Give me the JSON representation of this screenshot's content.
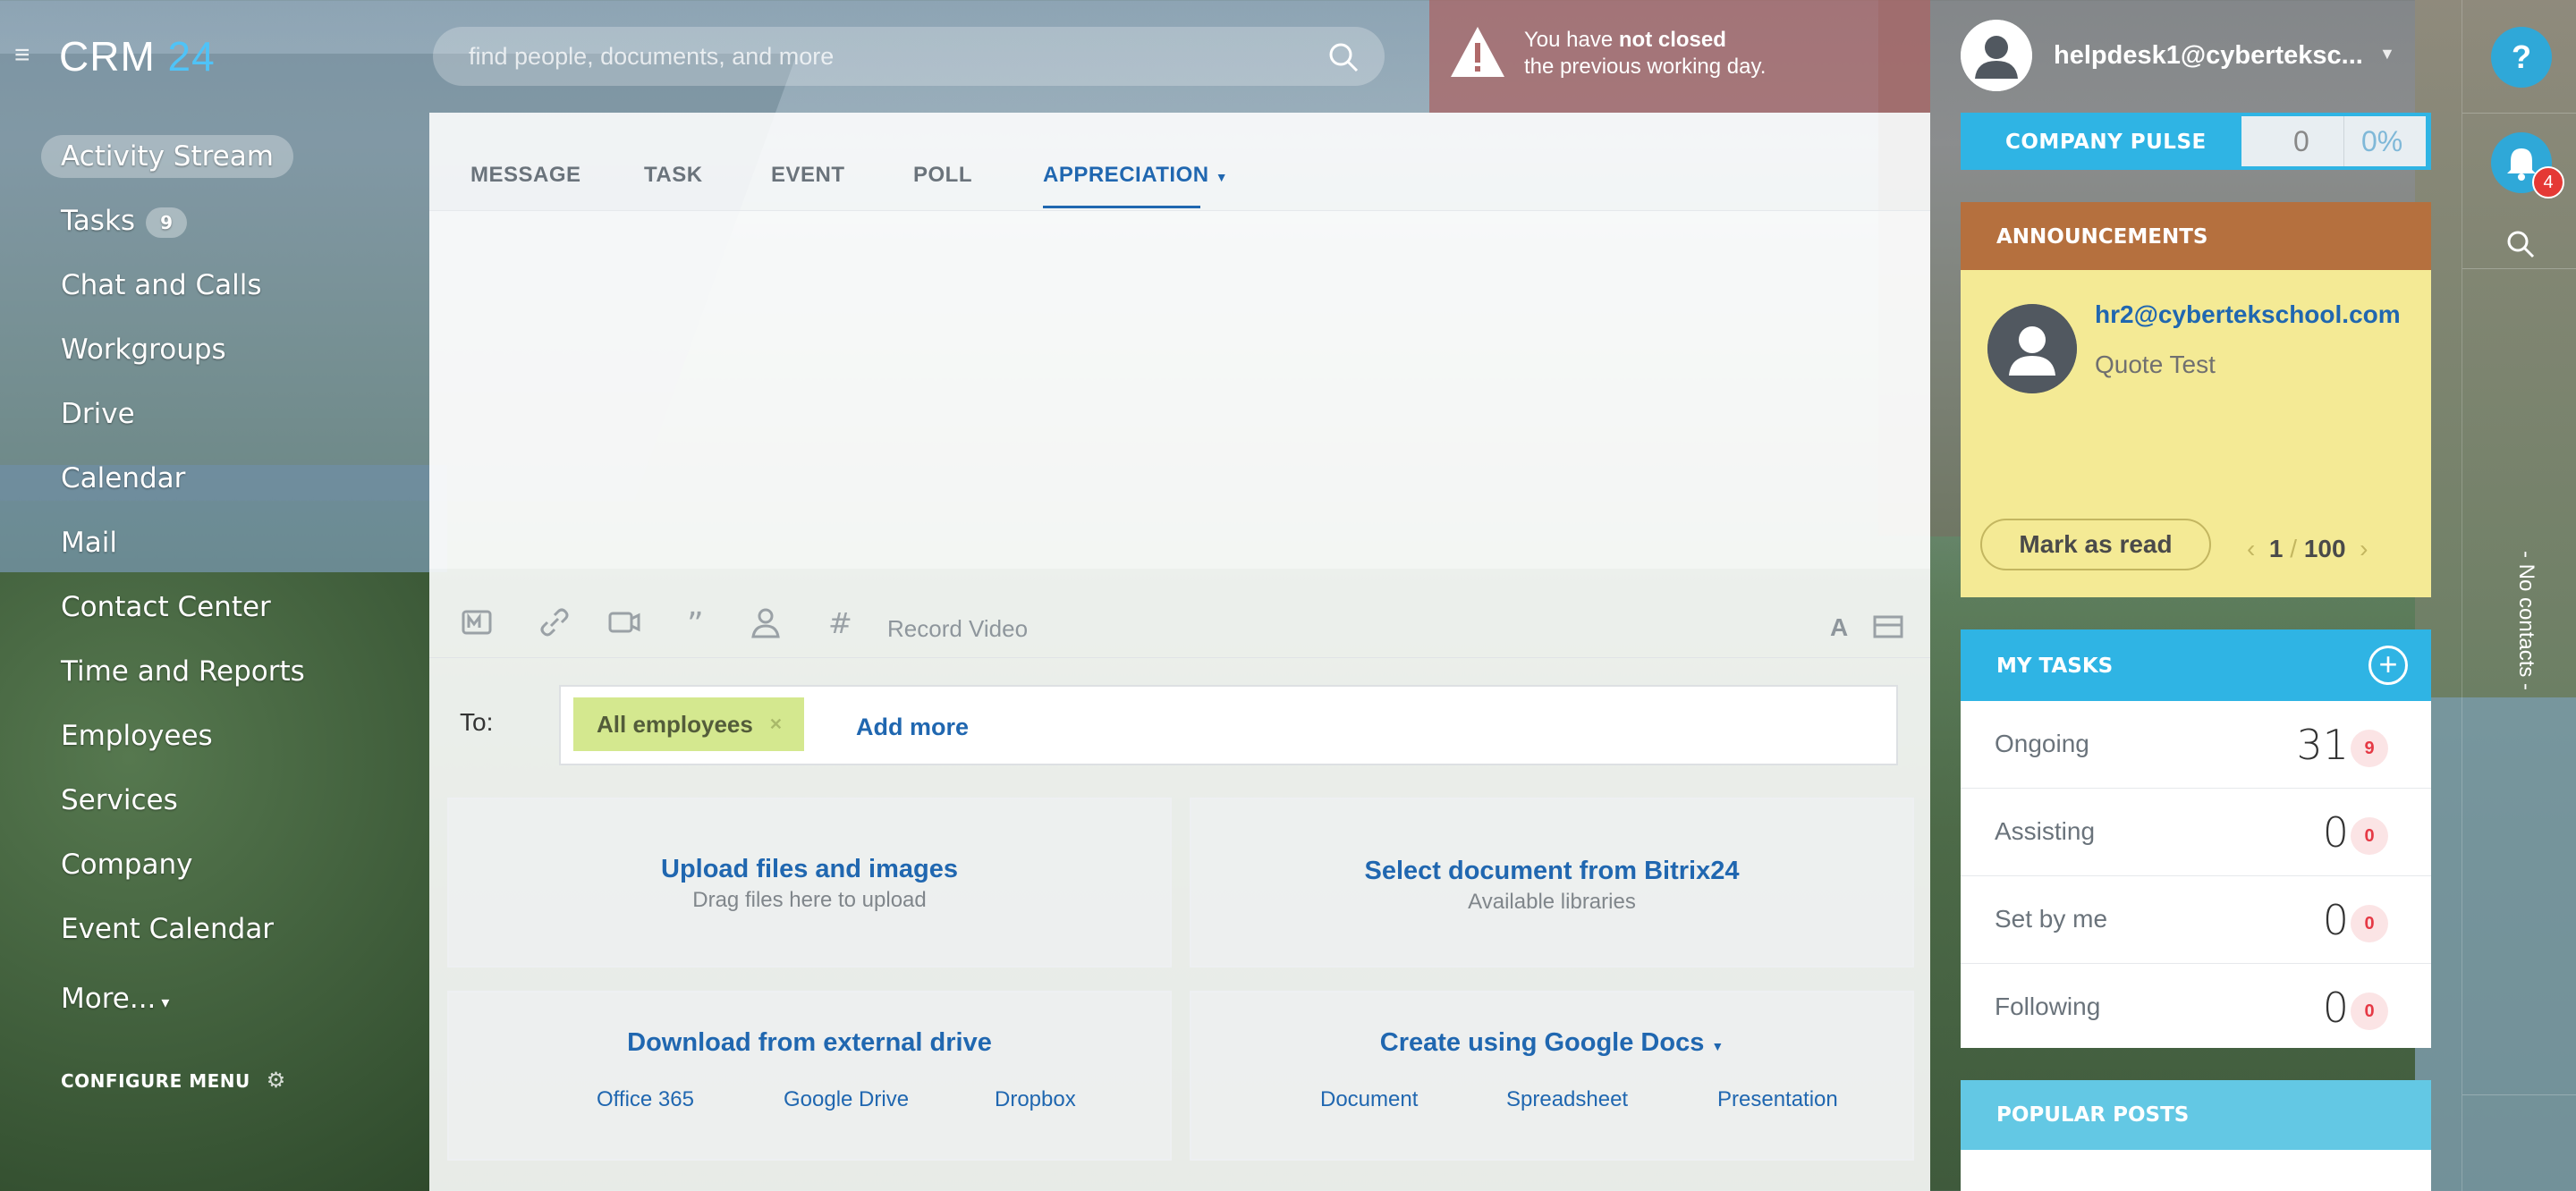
{
  "app": {
    "logo_main": "CRM",
    "logo_num": "24"
  },
  "sidebar": {
    "items": [
      {
        "label": "Activity Stream",
        "active": true
      },
      {
        "label": "Tasks",
        "badge": "9"
      },
      {
        "label": "Chat and Calls"
      },
      {
        "label": "Workgroups"
      },
      {
        "label": "Drive"
      },
      {
        "label": "Calendar"
      },
      {
        "label": "Mail"
      },
      {
        "label": "Contact Center"
      },
      {
        "label": "Time and Reports"
      },
      {
        "label": "Employees"
      },
      {
        "label": "Services"
      },
      {
        "label": "Company"
      },
      {
        "label": "Event Calendar"
      },
      {
        "label": "More..."
      }
    ],
    "configure": "CONFIGURE MENU"
  },
  "search": {
    "placeholder": "find people, documents, and more"
  },
  "warning": {
    "line1_pre": "You have ",
    "line1_bold": "not closed",
    "line2": "the previous working day."
  },
  "user": {
    "name": "helpdesk1@cyberteksc..."
  },
  "rail": {
    "help": "?",
    "notifications": "4",
    "no_contacts": "- No contacts -"
  },
  "composer": {
    "tabs": [
      "MESSAGE",
      "TASK",
      "EVENT",
      "POLL",
      "APPRECIATION"
    ],
    "active_tab": "APPRECIATION",
    "record_video": "Record Video",
    "to_label": "To:",
    "recipient": "All employees",
    "add_more": "Add more",
    "upload": {
      "title": "Upload files and images",
      "sub": "Drag files here to upload"
    },
    "bitrix": {
      "title": "Select document from Bitrix24",
      "sub": "Available libraries"
    },
    "external": {
      "title": "Download from external drive",
      "links": [
        "Office 365",
        "Google Drive",
        "Dropbox"
      ]
    },
    "gdocs": {
      "title": "Create using Google Docs",
      "links": [
        "Document",
        "Spreadsheet",
        "Presentation"
      ]
    }
  },
  "pulse": {
    "label": "COMPANY PULSE",
    "value": "0",
    "percent": "0%"
  },
  "announcements": {
    "label": "ANNOUNCEMENTS",
    "author": "hr2@cybertekschool.com",
    "text": "Quote Test",
    "mark_read": "Mark as read",
    "page": "1",
    "sep": "/",
    "total": "100"
  },
  "my_tasks": {
    "label": "MY TASKS",
    "rows": [
      {
        "name": "Ongoing",
        "count": "31",
        "badge": "9"
      },
      {
        "name": "Assisting",
        "count": "0",
        "badge": "0"
      },
      {
        "name": "Set by me",
        "count": "0",
        "badge": "0"
      },
      {
        "name": "Following",
        "count": "0",
        "badge": "0"
      }
    ]
  },
  "popular": {
    "label": "POPULAR POSTS"
  },
  "colors": {
    "accent": "#2067b0",
    "pulse": "#2fb4e4",
    "announce": "#b5703e",
    "announce_bg": "#f4ea95",
    "chip": "#d4e88f"
  }
}
